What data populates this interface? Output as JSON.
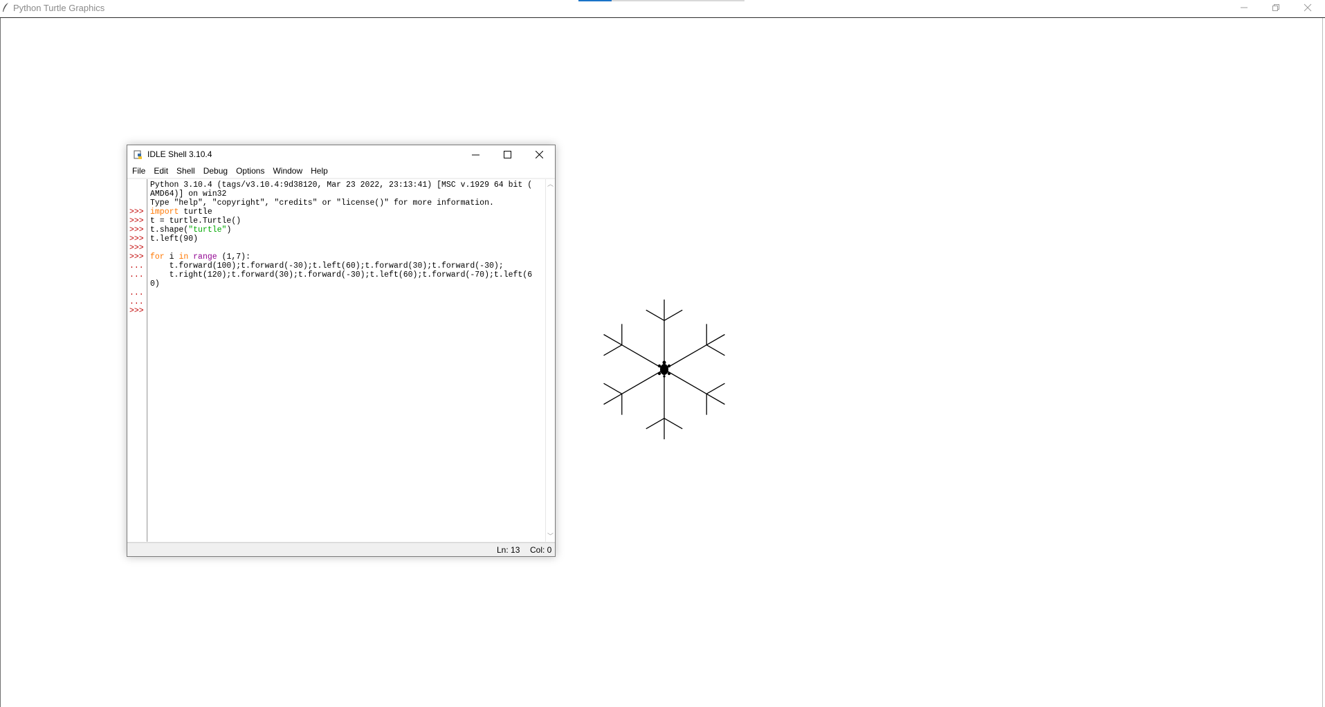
{
  "turtle_window": {
    "title": "Python Turtle Graphics",
    "icon": "feather-icon",
    "controls": [
      "minimize-icon",
      "restore-icon",
      "close-icon"
    ],
    "progress_fraction": 0.2,
    "accent_color": "#1a73c8"
  },
  "idle_window": {
    "title": "IDLE Shell 3.10.4",
    "icon": "python-idle-icon",
    "controls": [
      "minimize-icon",
      "maximize-icon",
      "close-icon"
    ],
    "menu": [
      "File",
      "Edit",
      "Shell",
      "Debug",
      "Options",
      "Window",
      "Help"
    ],
    "prompts": [
      "",
      "",
      "",
      ">>>",
      ">>>",
      ">>>",
      ">>>",
      ">>>",
      ">>>",
      "...",
      "...",
      "",
      "...",
      "...",
      ">>>"
    ],
    "lines": [
      "Python 3.10.4 (tags/v3.10.4:9d38120, Mar 23 2022, 23:13:41) [MSC v.1929 64 bit (",
      "AMD64)] on win32",
      "Type \"help\", \"copyright\", \"credits\" or \"license()\" for more information.",
      "import turtle",
      "t = turtle.Turtle()",
      "t.shape(\"turtle\")",
      "t.left(90)",
      "",
      "for i in range (1,7):",
      "    t.forward(100);t.forward(-30);t.left(60);t.forward(30);t.forward(-30);",
      "    t.right(120);t.forward(30);t.forward(-30);t.left(60);t.forward(-70);t.left(6",
      "0)",
      "",
      "",
      ""
    ],
    "status": {
      "line": "Ln: 13",
      "col": "Col: 0"
    },
    "syntax_colors": {
      "keyword": "#ff7700",
      "builtin": "#900090",
      "string": "#00aa00",
      "prompt": "#c00000"
    }
  },
  "drawing": {
    "shape": "snowflake",
    "arms": 6,
    "turtle_shape": "turtle",
    "pen_color": "#000000"
  }
}
